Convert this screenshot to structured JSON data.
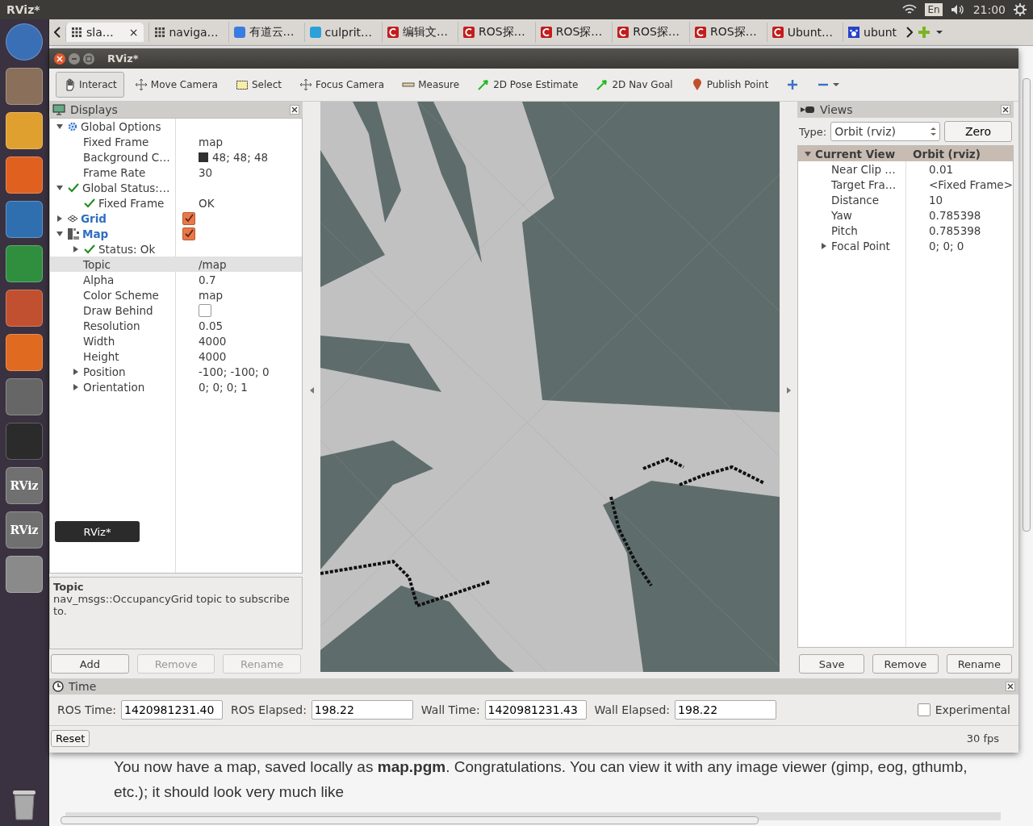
{
  "top_panel": {
    "title": "RViz*",
    "keyboard": "En",
    "time": "21:00"
  },
  "browser_tabs": [
    {
      "label": "sla…",
      "kind": "grid",
      "selected": true,
      "close": "×"
    },
    {
      "label": "naviga…",
      "kind": "grid",
      "selected": false
    },
    {
      "label": "有道云…",
      "kind": "note",
      "selected": false
    },
    {
      "label": "culprit…",
      "kind": "letter",
      "selected": false
    },
    {
      "label": "编辑文…",
      "kind": "swirl",
      "selected": false
    },
    {
      "label": "ROS探…",
      "kind": "swirl",
      "selected": false
    },
    {
      "label": "ROS探…",
      "kind": "swirl",
      "selected": false
    },
    {
      "label": "ROS探…",
      "kind": "swirl",
      "selected": false
    },
    {
      "label": "ROS探…",
      "kind": "swirl",
      "selected": false
    },
    {
      "label": "Ubunt…",
      "kind": "swirl",
      "selected": false
    },
    {
      "label": "ubunt",
      "kind": "paw",
      "selected": false
    }
  ],
  "launcher": [
    {
      "kind": "logo"
    },
    {
      "kind": "files"
    },
    {
      "kind": "browser"
    },
    {
      "kind": "browser2"
    },
    {
      "kind": "writer"
    },
    {
      "kind": "calc"
    },
    {
      "kind": "impress"
    },
    {
      "kind": "store"
    },
    {
      "kind": "settings"
    },
    {
      "kind": "terminal"
    },
    {
      "kind": "app",
      "label": "RViz"
    },
    {
      "kind": "app",
      "label": "RViz"
    },
    {
      "kind": "disk"
    }
  ],
  "launcher_tooltip": "RViz*",
  "rviz": {
    "title": "RViz*",
    "tools": [
      {
        "label": "Interact",
        "kind": "hand",
        "selected": true
      },
      {
        "label": "Move Camera",
        "kind": "move",
        "selected": false
      },
      {
        "label": "Select",
        "kind": "select",
        "selected": false
      },
      {
        "label": "Focus Camera",
        "kind": "focus",
        "selected": false
      },
      {
        "label": "Measure",
        "kind": "ruler",
        "selected": false
      },
      {
        "label": "2D Pose Estimate",
        "kind": "arrow",
        "selected": false
      },
      {
        "label": "2D Nav Goal",
        "kind": "arrow",
        "selected": false
      },
      {
        "label": "Publish Point",
        "kind": "pin",
        "selected": false
      },
      {
        "kind": "plus",
        "selected": false
      },
      {
        "kind": "minus",
        "selected": false
      }
    ],
    "displays": {
      "title": "Displays",
      "tree": [
        {
          "label": "Global Options",
          "kind": "options",
          "expanded": true,
          "selected": false,
          "children": [
            {
              "label": "Fixed Frame",
              "value": "map",
              "selected": false
            },
            {
              "label": "Background C…",
              "value": "48; 48; 48",
              "color": "#303030",
              "selected": false
            },
            {
              "label": "Frame Rate",
              "value": "30",
              "selected": false
            }
          ]
        },
        {
          "label": "Global Status:…",
          "kind": "status",
          "expanded": true,
          "selected": false,
          "children": [
            {
              "label": "Fixed Frame",
              "kind": "status",
              "value": "OK",
              "selected": false
            }
          ]
        },
        {
          "label": "Grid",
          "kind": "grid",
          "expanded": false,
          "checked": true,
          "selected": false
        },
        {
          "label": "Map",
          "kind": "map",
          "expanded": true,
          "checked": true,
          "selected": false,
          "children": [
            {
              "label": "Status: Ok",
              "kind": "status",
              "expanded": false,
              "selected": false
            },
            {
              "label": "Topic",
              "value": "/map",
              "selected": true
            },
            {
              "label": "Alpha",
              "value": "0.7",
              "selected": false
            },
            {
              "label": "Color Scheme",
              "value": "map",
              "selected": false
            },
            {
              "label": "Draw Behind",
              "checked": false,
              "selected": false
            },
            {
              "label": "Resolution",
              "value": "0.05",
              "selected": false
            },
            {
              "label": "Width",
              "value": "4000",
              "selected": false
            },
            {
              "label": "Height",
              "value": "4000",
              "selected": false
            },
            {
              "label": "Position",
              "value": "-100; -100; 0",
              "expanded": false,
              "selected": false
            },
            {
              "label": "Orientation",
              "value": "0; 0; 0; 1",
              "expanded": false,
              "selected": false
            }
          ]
        }
      ],
      "help_title": "Topic",
      "help_text": "nav_msgs::OccupancyGrid topic to subscribe to.",
      "buttons": [
        {
          "label": "Add",
          "disabled": false
        },
        {
          "label": "Remove",
          "disabled": true
        },
        {
          "label": "Rename",
          "disabled": true
        }
      ]
    },
    "views": {
      "title": "Views",
      "type_label": "Type:",
      "type_value": "Orbit (rviz)",
      "zero": "Zero",
      "tree": [
        {
          "label": "Current View",
          "value": "Orbit (rviz)",
          "expanded": true,
          "selected": true,
          "children": [
            {
              "label": "Near Clip …",
              "value": "0.01",
              "selected": false
            },
            {
              "label": "Target Fra…",
              "value": "<Fixed Frame>",
              "selected": false
            },
            {
              "label": "Distance",
              "value": "10",
              "selected": false
            },
            {
              "label": "Yaw",
              "value": "0.785398",
              "selected": false
            },
            {
              "label": "Pitch",
              "value": "0.785398",
              "selected": false
            },
            {
              "label": "Focal Point",
              "value": "0; 0; 0",
              "expanded": false,
              "selected": false
            }
          ]
        }
      ],
      "buttons": [
        {
          "label": "Save",
          "disabled": false
        },
        {
          "label": "Remove",
          "disabled": false
        },
        {
          "label": "Rename",
          "disabled": false
        }
      ]
    },
    "time": {
      "title": "Time",
      "fields": [
        {
          "label": "ROS Time:",
          "value": "1420981231.40"
        },
        {
          "label": "ROS Elapsed:",
          "value": "198.22"
        },
        {
          "label": "Wall Time:",
          "value": "1420981231.43"
        },
        {
          "label": "Wall Elapsed:",
          "value": "198.22"
        }
      ],
      "experimental": {
        "label": "Experimental",
        "checked": false
      },
      "reset": "Reset",
      "fps": "30 fps"
    }
  },
  "page_text": "You now have a map, saved locally as **map.pgm**. Congratulations. You can view it with any image viewer (gimp, eog, gthumb, etc.); it should look very much like"
}
